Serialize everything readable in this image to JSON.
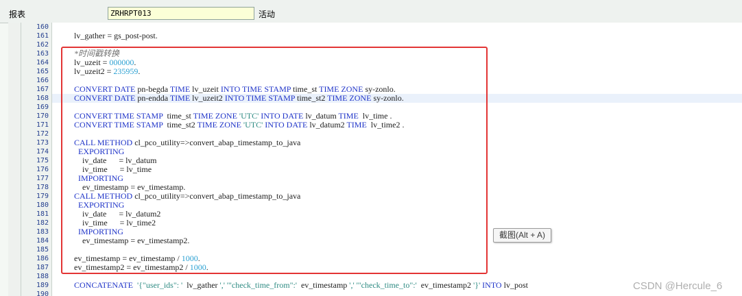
{
  "header": {
    "program_label": "报表",
    "program_name": "ZRHRPT013",
    "status": "活动"
  },
  "editor": {
    "lines": [
      {
        "num": "160",
        "tokens": []
      },
      {
        "num": "161",
        "tokens": [
          {
            "t": "lv_gather = gs_post-post.",
            "c": "tx"
          }
        ]
      },
      {
        "num": "162",
        "tokens": []
      },
      {
        "num": "163",
        "tokens": [
          {
            "t": "*时间戳转换",
            "c": "cm"
          }
        ]
      },
      {
        "num": "164",
        "tokens": [
          {
            "t": "lv_uzeit = ",
            "c": "tx"
          },
          {
            "t": "000000",
            "c": "num"
          },
          {
            "t": ".",
            "c": "tx"
          }
        ]
      },
      {
        "num": "165",
        "tokens": [
          {
            "t": "lv_uzeit2 = ",
            "c": "tx"
          },
          {
            "t": "235959",
            "c": "num"
          },
          {
            "t": ".",
            "c": "tx"
          }
        ]
      },
      {
        "num": "166",
        "tokens": []
      },
      {
        "num": "167",
        "tokens": [
          {
            "t": "CONVERT DATE",
            "c": "kw"
          },
          {
            "t": " pn-begda ",
            "c": "tx"
          },
          {
            "t": "TIME",
            "c": "kw"
          },
          {
            "t": " lv_uzeit ",
            "c": "tx"
          },
          {
            "t": "INTO TIME STAMP",
            "c": "kw"
          },
          {
            "t": " time_st ",
            "c": "tx"
          },
          {
            "t": "TIME ZONE",
            "c": "kw"
          },
          {
            "t": " sy-zonlo.",
            "c": "tx"
          }
        ]
      },
      {
        "num": "168",
        "tokens": [
          {
            "t": "CONVERT DATE",
            "c": "kw"
          },
          {
            "t": " pn-endda ",
            "c": "tx"
          },
          {
            "t": "TIME",
            "c": "kw"
          },
          {
            "t": " lv_uzeit2 ",
            "c": "tx"
          },
          {
            "t": "INTO TIME STAMP",
            "c": "kw"
          },
          {
            "t": " time_st2 ",
            "c": "tx"
          },
          {
            "t": "TIME ZONE",
            "c": "kw"
          },
          {
            "t": " sy-zonlo.",
            "c": "tx"
          }
        ]
      },
      {
        "num": "169",
        "tokens": []
      },
      {
        "num": "170",
        "tokens": [
          {
            "t": "CONVERT TIME STAMP",
            "c": "kw"
          },
          {
            "t": "  time_st ",
            "c": "tx"
          },
          {
            "t": "TIME ZONE",
            "c": "kw"
          },
          {
            "t": " ",
            "c": "tx"
          },
          {
            "t": "'UTC'",
            "c": "str"
          },
          {
            "t": " ",
            "c": "tx"
          },
          {
            "t": "INTO DATE",
            "c": "kw"
          },
          {
            "t": " lv_datum ",
            "c": "tx"
          },
          {
            "t": "TIME",
            "c": "kw"
          },
          {
            "t": "  lv_time .",
            "c": "tx"
          }
        ]
      },
      {
        "num": "171",
        "tokens": [
          {
            "t": "CONVERT TIME STAMP",
            "c": "kw"
          },
          {
            "t": "  time_st2 ",
            "c": "tx"
          },
          {
            "t": "TIME ZONE",
            "c": "kw"
          },
          {
            "t": " ",
            "c": "tx"
          },
          {
            "t": "'UTC'",
            "c": "str"
          },
          {
            "t": " ",
            "c": "tx"
          },
          {
            "t": "INTO DATE",
            "c": "kw"
          },
          {
            "t": " lv_datum2 ",
            "c": "tx"
          },
          {
            "t": "TIME",
            "c": "kw"
          },
          {
            "t": "  lv_time2 .",
            "c": "tx"
          }
        ]
      },
      {
        "num": "172",
        "tokens": []
      },
      {
        "num": "173",
        "tokens": [
          {
            "t": "CALL METHOD",
            "c": "kw"
          },
          {
            "t": " cl_pco_utility=>convert_abap_timestamp_to_java",
            "c": "tx"
          }
        ]
      },
      {
        "num": "174",
        "tokens": [
          {
            "t": "  EXPORTING",
            "c": "kw"
          }
        ]
      },
      {
        "num": "175",
        "tokens": [
          {
            "t": "    iv_date      = lv_datum",
            "c": "tx"
          }
        ]
      },
      {
        "num": "176",
        "tokens": [
          {
            "t": "    iv_time      = lv_time",
            "c": "tx"
          }
        ]
      },
      {
        "num": "177",
        "tokens": [
          {
            "t": "  IMPORTING",
            "c": "kw"
          }
        ]
      },
      {
        "num": "178",
        "tokens": [
          {
            "t": "    ev_timestamp = ev_timestamp.",
            "c": "tx"
          }
        ]
      },
      {
        "num": "179",
        "tokens": [
          {
            "t": "CALL METHOD",
            "c": "kw"
          },
          {
            "t": " cl_pco_utility=>convert_abap_timestamp_to_java",
            "c": "tx"
          }
        ]
      },
      {
        "num": "180",
        "tokens": [
          {
            "t": "  EXPORTING",
            "c": "kw"
          }
        ]
      },
      {
        "num": "181",
        "tokens": [
          {
            "t": "    iv_date      = lv_datum2",
            "c": "tx"
          }
        ]
      },
      {
        "num": "182",
        "tokens": [
          {
            "t": "    iv_time      = lv_time2",
            "c": "tx"
          }
        ]
      },
      {
        "num": "183",
        "tokens": [
          {
            "t": "  IMPORTING",
            "c": "kw"
          }
        ]
      },
      {
        "num": "184",
        "tokens": [
          {
            "t": "    ev_timestamp = ev_timestamp2.",
            "c": "tx"
          }
        ]
      },
      {
        "num": "185",
        "tokens": []
      },
      {
        "num": "186",
        "tokens": [
          {
            "t": "ev_timestamp = ev_timestamp / ",
            "c": "tx"
          },
          {
            "t": "1000",
            "c": "num"
          },
          {
            "t": ".",
            "c": "tx"
          }
        ]
      },
      {
        "num": "187",
        "tokens": [
          {
            "t": "ev_timestamp2 = ev_timestamp2 / ",
            "c": "tx"
          },
          {
            "t": "1000",
            "c": "num"
          },
          {
            "t": ".",
            "c": "tx"
          }
        ]
      },
      {
        "num": "188",
        "tokens": []
      },
      {
        "num": "189",
        "tokens": [
          {
            "t": "CONCATENATE",
            "c": "kw"
          },
          {
            "t": "  ",
            "c": "tx"
          },
          {
            "t": "'{\"user_ids\": '",
            "c": "str"
          },
          {
            "t": "  lv_gather ",
            "c": "tx"
          },
          {
            "t": "','",
            "c": "str"
          },
          {
            "t": " ",
            "c": "tx"
          },
          {
            "t": "'\"check_time_from\":'",
            "c": "str"
          },
          {
            "t": "  ev_timestamp ",
            "c": "tx"
          },
          {
            "t": "','",
            "c": "str"
          },
          {
            "t": " ",
            "c": "tx"
          },
          {
            "t": "'\"check_time_to\":'",
            "c": "str"
          },
          {
            "t": "  ev_timestamp2 ",
            "c": "tx"
          },
          {
            "t": "'}'",
            "c": "str"
          },
          {
            "t": " ",
            "c": "tx"
          },
          {
            "t": "INTO",
            "c": "kw"
          },
          {
            "t": " lv_post",
            "c": "tx"
          }
        ]
      },
      {
        "num": "190",
        "tokens": []
      }
    ],
    "highlighted_line": "168"
  },
  "tooltip": {
    "text": "截图(Alt + A)"
  },
  "watermark": {
    "text": "CSDN @Hercule_6"
  }
}
